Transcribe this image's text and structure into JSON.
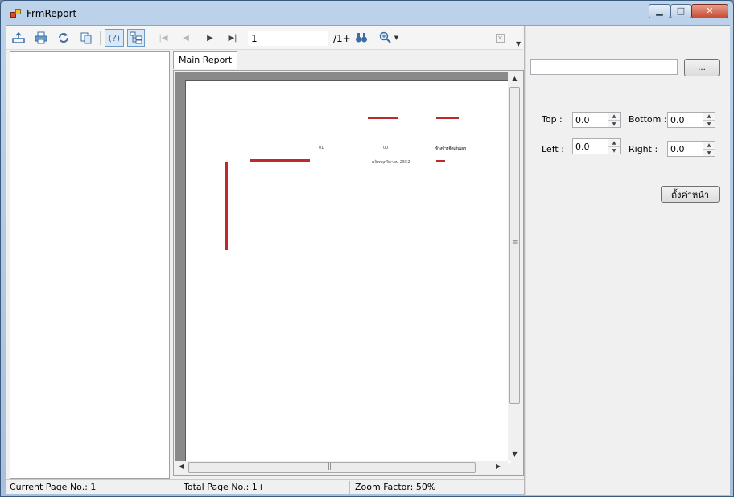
{
  "window": {
    "title": "FrmReport"
  },
  "window_buttons": {
    "minimize_glyph": "▁",
    "maximize_glyph": "□",
    "close_glyph": "✕"
  },
  "toolbar": {
    "icons": {
      "export": "export-icon",
      "print": "print-icon",
      "refresh": "refresh-icon",
      "copy": "copy-icon",
      "help": "help-icon",
      "group_tree": "group-tree-icon",
      "first": "first-page-icon",
      "prev": "previous-page-icon",
      "next": "next-page-icon",
      "last": "last-page-icon",
      "search": "binoculars-icon",
      "zoom": "zoom-icon"
    },
    "help_label": "(?)",
    "page_value": "1",
    "page_of": "/1+"
  },
  "report": {
    "tab_label": "Main Report",
    "texts": {
      "header_col1": "01",
      "header_col2": "00",
      "header_col3": "จ้างจ้างจัดเก็บเอก",
      "row_date": "แจ้งพฤศจิกายน 2552"
    }
  },
  "statusbar": {
    "current_page": "Current Page No.: 1",
    "total_page": "Total Page No.: 1+",
    "zoom": "Zoom Factor: 50%"
  },
  "settings": {
    "path_value": "",
    "browse_label": "...",
    "top_label": "Top :",
    "top_value": "0.0",
    "bottom_label": "Bottom :",
    "bottom_value": "0.0",
    "left_label": "Left :",
    "left_value": "0.0",
    "right_label": "Right :",
    "right_value": "0.0",
    "set_page_label": "ตั้งค่าหน้า"
  },
  "colors": {
    "accent": "#3a6ea5",
    "report_mark": "#c0282b",
    "titlebar": "#bcd3ea"
  }
}
